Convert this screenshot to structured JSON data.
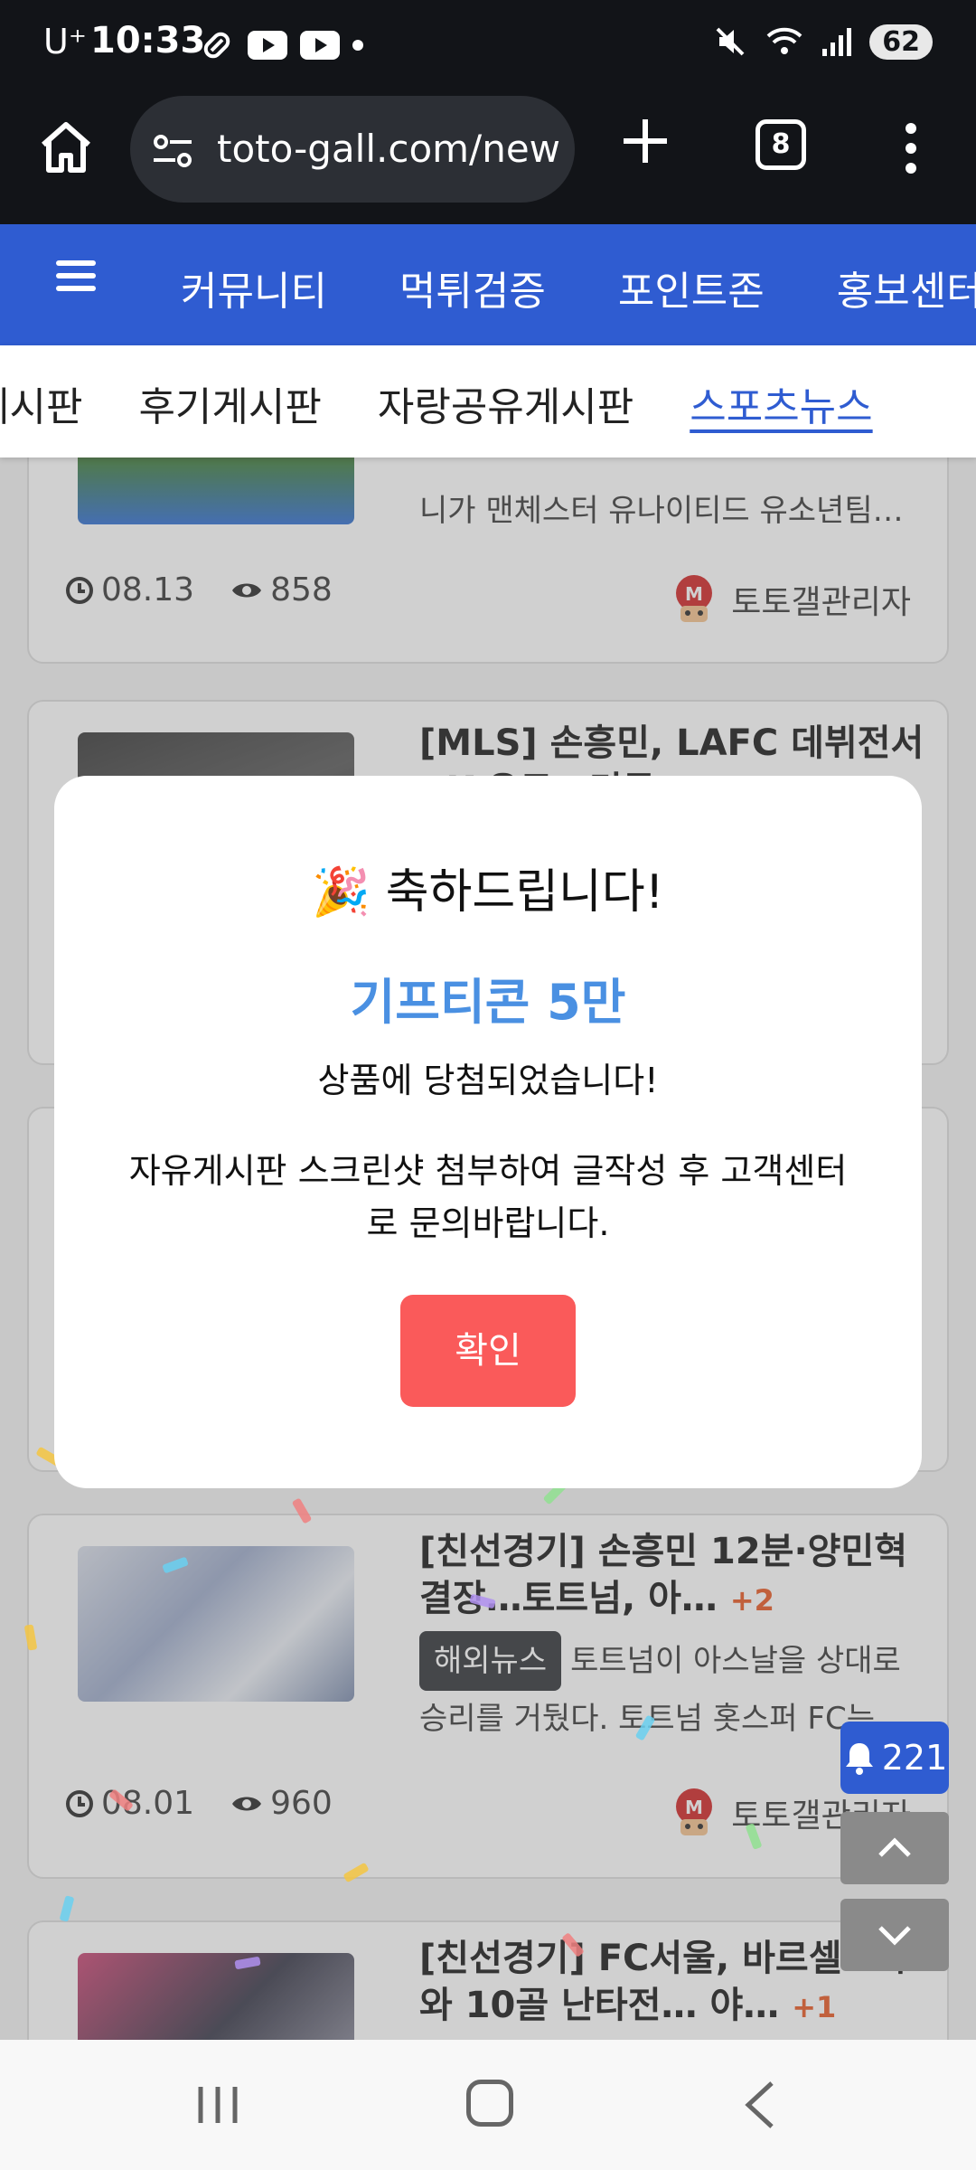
{
  "status_bar": {
    "carrier": "U⁺",
    "time": "10:33",
    "battery": "62"
  },
  "browser": {
    "url": "toto-gall.com/new",
    "tab_count": "8"
  },
  "site_nav": {
    "items": [
      "커뮤니티",
      "먹튀검증",
      "포인트존",
      "홍보센터"
    ]
  },
  "sub_nav": {
    "items": [
      "게시판",
      "후기게시판",
      "자랑공유게시판",
      "스포츠뉴스"
    ],
    "active": "스포츠뉴스"
  },
  "posts": [
    {
      "summary": "니가 맨체스터 유나이티드 유소년팀…",
      "date": "08.13",
      "views": "858",
      "author": "토토갤관리자"
    },
    {
      "title": "[MLS] 손흥민, LAFC 데뷔전서 PK 유도…미국"
    },
    {
      "title": "[친선경기] 손흥민 12분·양민혁 결장…토트넘, 아…",
      "comments": "+2",
      "tag": "해외뉴스",
      "summary": "토트넘이 아스날을 상대로 승리를 거뒀다. 토트넘 홋스퍼 FC는 …",
      "date": "08.01",
      "views": "960",
      "author": "토토갤관리자"
    },
    {
      "title": "[친선경기] FC서울, 바르셀로나와 10골 난타전… 야…",
      "comments": "+1"
    }
  ],
  "floating": {
    "notification_count": "221"
  },
  "modal": {
    "emoji": "🎉",
    "title": "축하드립니다!",
    "prize": "기프티콘 5만",
    "subtitle": "상품에 당첨되었습니다!",
    "description": "자유게시판 스크린샷 첨부하여 글작성 후 고객센터로 문의바랍니다.",
    "confirm_label": "확인"
  },
  "colors": {
    "brand_blue": "#2f5cd1",
    "prize_blue": "#4a90e2",
    "confirm_red": "#fa5a5a"
  }
}
